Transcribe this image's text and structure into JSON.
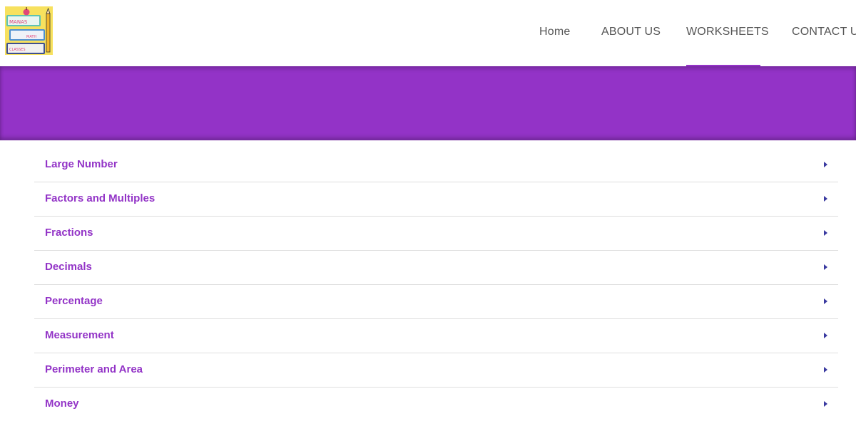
{
  "logo": {
    "book_top_text": "MANAS",
    "book_middle_text": "MATH",
    "book_bottom_text": "CLASSES"
  },
  "nav": {
    "items": [
      {
        "label": "Home"
      },
      {
        "label": "ABOUT US"
      },
      {
        "label": "WORKSHEETS"
      },
      {
        "label": "CONTACT US"
      }
    ],
    "active": "WORKSHEETS"
  },
  "colors": {
    "accent": "#9333c7",
    "arrow": "#3a3aa0"
  },
  "accordion": {
    "items": [
      {
        "label": "Large Number",
        "icon": "caret-right-icon"
      },
      {
        "label": "Factors and Multiples",
        "icon": "caret-right-icon"
      },
      {
        "label": "Fractions",
        "icon": "caret-right-icon"
      },
      {
        "label": "Decimals",
        "icon": "caret-right-icon"
      },
      {
        "label": "Percentage",
        "icon": "caret-right-icon"
      },
      {
        "label": "Measurement",
        "icon": "caret-right-icon"
      },
      {
        "label": "Perimeter and Area",
        "icon": "caret-right-icon"
      },
      {
        "label": "Money",
        "icon": "caret-right-icon"
      }
    ]
  }
}
